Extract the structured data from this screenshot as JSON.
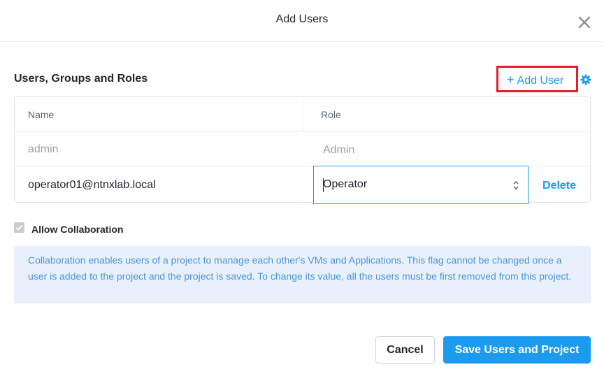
{
  "dialog": {
    "title": "Add Users"
  },
  "section": {
    "title": "Users, Groups and Roles",
    "add_user_label": "Add User"
  },
  "table": {
    "headers": [
      "Name",
      "Role"
    ],
    "rows": [
      {
        "name": "admin",
        "role": "Admin"
      },
      {
        "name": "operator01@ntnxlab.local",
        "role": "Operator",
        "action": "Delete"
      }
    ]
  },
  "collaboration": {
    "checkbox_label": "Allow Collaboration",
    "checked": true,
    "info_text": "Collaboration enables users of a project to manage each other's VMs and Applications. This flag cannot be changed once a user is added to the project and the project is saved. To change its value, all the users must be first removed from this project."
  },
  "footer": {
    "cancel_label": "Cancel",
    "save_label": "Save Users and Project"
  },
  "colors": {
    "accent": "#1a9bf0",
    "highlight_box": "#e0202a",
    "info_bg": "#e8f1fb"
  },
  "icons": {
    "close": "close-icon",
    "plus": "plus-icon",
    "gear": "gear-icon",
    "select_arrows": "sort-arrows-icon",
    "checkbox": "checkmark-icon"
  }
}
